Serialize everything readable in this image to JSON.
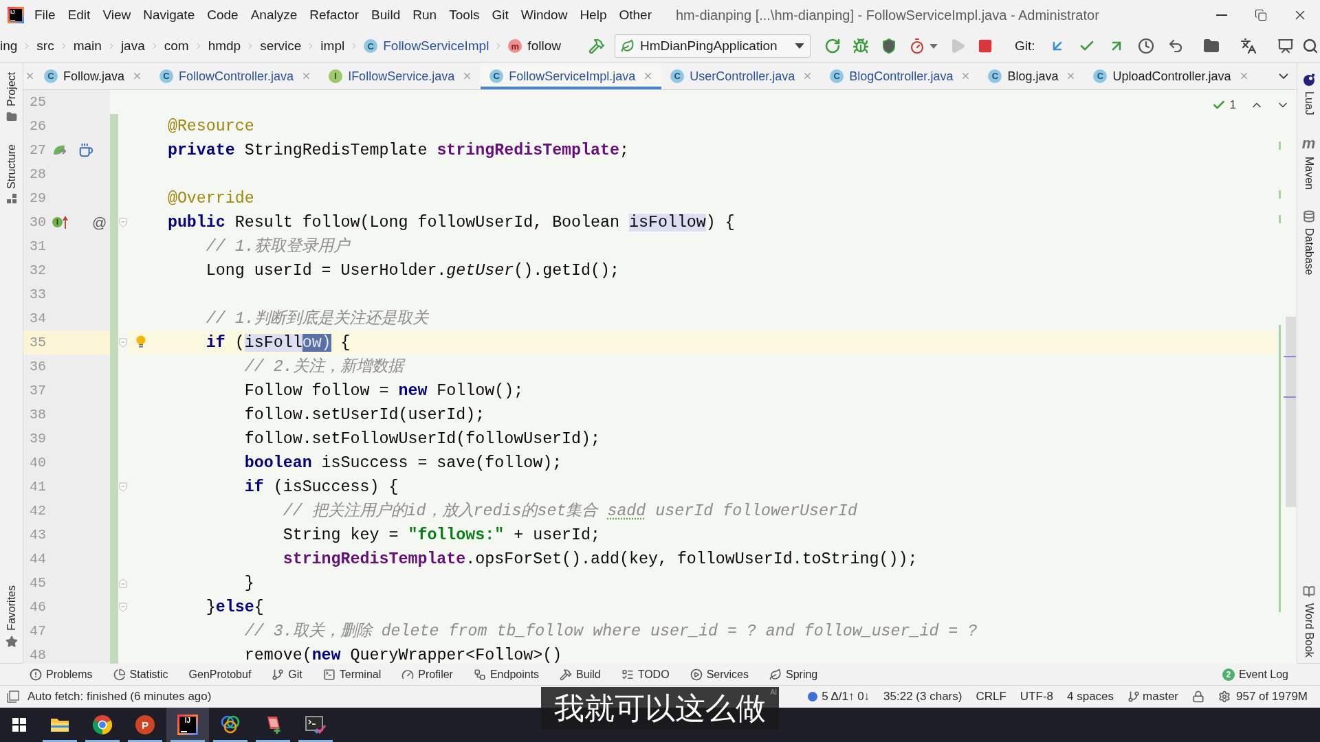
{
  "window": {
    "logo": "IJ",
    "menu": [
      {
        "label": "File"
      },
      {
        "label": "Edit"
      },
      {
        "label": "View"
      },
      {
        "label": "Navigate"
      },
      {
        "label": "Code"
      },
      {
        "label": "Analyze"
      },
      {
        "label": "Refactor"
      },
      {
        "label": "Build"
      },
      {
        "label": "Run"
      },
      {
        "label": "Tools"
      },
      {
        "label": "Git"
      },
      {
        "label": "Window"
      },
      {
        "label": "Help"
      },
      {
        "label": "Other"
      }
    ],
    "title": "hm-dianping [...\\hm-dianping] - FollowServiceImpl.java - Administrator"
  },
  "navigation_bar": {
    "breadcrumbs": [
      {
        "label": "ing",
        "kind": "module"
      },
      {
        "label": "src",
        "kind": "folder"
      },
      {
        "label": "main",
        "kind": "folder"
      },
      {
        "label": "java",
        "kind": "folder"
      },
      {
        "label": "com",
        "kind": "package"
      },
      {
        "label": "hmdp",
        "kind": "package"
      },
      {
        "label": "service",
        "kind": "package"
      },
      {
        "label": "impl",
        "kind": "package"
      },
      {
        "label": "FollowServiceImpl",
        "kind": "class",
        "glyph": "C"
      },
      {
        "label": "follow",
        "kind": "method",
        "glyph": "m"
      }
    ],
    "run_configuration": "HmDianPingApplication",
    "toolbar": [
      {
        "kind": "rerun",
        "disabled": false
      },
      {
        "kind": "debug",
        "disabled": false
      },
      {
        "kind": "coverage",
        "disabled": false
      },
      {
        "kind": "profiler",
        "disabled": false
      },
      {
        "kind": "run",
        "disabled": true
      },
      {
        "kind": "stop",
        "disabled": false
      }
    ],
    "git_label": "Git:"
  },
  "editor_tabs": [
    {
      "glyph": "C",
      "kind": "class",
      "label": "Follow.java",
      "modified": false,
      "selected": false
    },
    {
      "glyph": "C",
      "kind": "class",
      "label": "FollowController.java",
      "modified": true,
      "selected": false
    },
    {
      "glyph": "I",
      "kind": "interface",
      "label": "IFollowService.java",
      "modified": true,
      "selected": false
    },
    {
      "glyph": "C",
      "kind": "class",
      "label": "FollowServiceImpl.java",
      "modified": true,
      "selected": true
    },
    {
      "glyph": "C",
      "kind": "class",
      "label": "UserController.java",
      "modified": true,
      "selected": false
    },
    {
      "glyph": "C",
      "kind": "class",
      "label": "BlogController.java",
      "modified": true,
      "selected": false
    },
    {
      "glyph": "C",
      "kind": "class",
      "label": "Blog.java",
      "modified": false,
      "selected": false
    },
    {
      "glyph": "C",
      "kind": "class",
      "label": "UploadController.java",
      "modified": false,
      "selected": false
    }
  ],
  "left_stripe": [
    {
      "label": "Project",
      "kind": "project"
    },
    {
      "label": "Structure",
      "kind": "structure"
    },
    {
      "label": "Favorites",
      "kind": "favorites"
    }
  ],
  "right_stripe": [
    {
      "label": "LuaJ",
      "kind": "luaj"
    },
    {
      "label": "Maven",
      "kind": "maven",
      "glyph": "m"
    },
    {
      "label": "Database",
      "kind": "database"
    },
    {
      "label": "Word Book",
      "kind": "wordbook"
    }
  ],
  "editor": {
    "inspections": "1",
    "lines": [
      {
        "number": "25",
        "changed": false,
        "current": false
      },
      {
        "number": "26",
        "changed": true,
        "current": false,
        "segments": [
          {
            "text": "    @Resource",
            "kind": "annotation"
          }
        ]
      },
      {
        "number": "27",
        "changed": true,
        "current": false,
        "markers": [
          {
            "kind": "bean"
          },
          {
            "kind": "java"
          }
        ],
        "segments": [
          {
            "text": "    private",
            "kind": "keyword"
          },
          {
            "text": " StringRedisTemplate ",
            "kind": "plain"
          },
          {
            "text": "stringRedisTemplate",
            "kind": "field"
          },
          {
            "text": ";",
            "kind": "plain"
          }
        ]
      },
      {
        "number": "28",
        "changed": true,
        "current": false
      },
      {
        "number": "29",
        "changed": true,
        "current": false,
        "segments": [
          {
            "text": "    @Override",
            "kind": "annotation"
          }
        ]
      },
      {
        "number": "30",
        "changed": true,
        "current": false,
        "fold_start": true,
        "markers": [
          {
            "kind": "implements",
            "glyph": "I"
          },
          {
            "kind": "annotation",
            "glyph": "@"
          }
        ],
        "segments": [
          {
            "text": "    public",
            "kind": "keyword"
          },
          {
            "text": " Result follow(Long followUserId, Boolean ",
            "kind": "plain"
          },
          {
            "text": "isFollow",
            "kind": "usage"
          },
          {
            "text": ") {",
            "kind": "plain"
          }
        ]
      },
      {
        "number": "31",
        "changed": true,
        "current": false,
        "segments": [
          {
            "text": "        // 1.获取登录用户",
            "kind": "comment"
          }
        ]
      },
      {
        "number": "32",
        "changed": true,
        "current": false,
        "segments": [
          {
            "text": "        Long userId = UserHolder.",
            "kind": "plain"
          },
          {
            "text": "getUser",
            "kind": "static"
          },
          {
            "text": "().getId();",
            "kind": "plain"
          }
        ]
      },
      {
        "number": "33",
        "changed": true,
        "current": false
      },
      {
        "number": "34",
        "changed": true,
        "current": false,
        "segments": [
          {
            "text": "        // 1.判断到底是关注还是取关",
            "kind": "comment"
          }
        ]
      },
      {
        "number": "35",
        "changed": true,
        "current": true,
        "fold_start": true,
        "bulb": true,
        "segments": [
          {
            "text": "        if",
            "kind": "keyword"
          },
          {
            "text": " (",
            "kind": "plain"
          },
          {
            "text": "isFoll",
            "kind": "usage"
          },
          {
            "text": "ow)",
            "kind": "selection"
          },
          {
            "text": " {",
            "kind": "plain"
          }
        ]
      },
      {
        "number": "36",
        "changed": true,
        "current": false,
        "segments": [
          {
            "text": "            // 2.关注，新增数据",
            "kind": "comment"
          }
        ]
      },
      {
        "number": "37",
        "changed": true,
        "current": false,
        "segments": [
          {
            "text": "            Follow follow = ",
            "kind": "plain"
          },
          {
            "text": "new",
            "kind": "keyword"
          },
          {
            "text": " Follow();",
            "kind": "plain"
          }
        ]
      },
      {
        "number": "38",
        "changed": true,
        "current": false,
        "segments": [
          {
            "text": "            follow.setUserId(userId);",
            "kind": "plain"
          }
        ]
      },
      {
        "number": "39",
        "changed": true,
        "current": false,
        "segments": [
          {
            "text": "            follow.setFollowUserId(followUserId);",
            "kind": "plain"
          }
        ]
      },
      {
        "number": "40",
        "changed": true,
        "current": false,
        "segments": [
          {
            "text": "            boolean",
            "kind": "keyword"
          },
          {
            "text": " isSuccess = save(follow);",
            "kind": "plain"
          }
        ]
      },
      {
        "number": "41",
        "changed": true,
        "current": false,
        "fold_start": true,
        "segments": [
          {
            "text": "            if",
            "kind": "keyword"
          },
          {
            "text": " (isSuccess) {",
            "kind": "plain"
          }
        ]
      },
      {
        "number": "42",
        "changed": true,
        "current": false,
        "segments": [
          {
            "text": "                // 把关注用户的id，放入redis的set集合 ",
            "kind": "comment"
          },
          {
            "text": "sadd",
            "kind": "typo"
          },
          {
            "text": " userId followerUserId",
            "kind": "comment"
          }
        ]
      },
      {
        "number": "43",
        "changed": true,
        "current": false,
        "segments": [
          {
            "text": "                String key = ",
            "kind": "plain"
          },
          {
            "text": "\"follows:\"",
            "kind": "string"
          },
          {
            "text": " + userId;",
            "kind": "plain"
          }
        ]
      },
      {
        "number": "44",
        "changed": true,
        "current": false,
        "segments": [
          {
            "text": "                stringRedisTemplate",
            "kind": "field"
          },
          {
            "text": ".opsForSet().add(key, followUserId.toString());",
            "kind": "plain"
          }
        ]
      },
      {
        "number": "45",
        "changed": true,
        "current": false,
        "fold_end": true,
        "segments": [
          {
            "text": "            }",
            "kind": "plain"
          }
        ]
      },
      {
        "number": "46",
        "changed": true,
        "current": false,
        "fold_start": true,
        "segments": [
          {
            "text": "        }",
            "kind": "plain"
          },
          {
            "text": "else",
            "kind": "keyword"
          },
          {
            "text": "{",
            "kind": "plain"
          }
        ]
      },
      {
        "number": "47",
        "changed": true,
        "current": false,
        "segments": [
          {
            "text": "            // 3.取关，删除 delete from tb_follow where user_id = ? and follow_user_id = ?",
            "kind": "comment"
          }
        ]
      },
      {
        "number": "48",
        "changed": true,
        "current": false,
        "segments": [
          {
            "text": "            remove(",
            "kind": "plain"
          },
          {
            "text": "new",
            "kind": "keyword"
          },
          {
            "text": " QueryWrapper<Follow>()",
            "kind": "plain"
          }
        ]
      }
    ]
  },
  "tool_windows": [
    {
      "label": "Problems",
      "kind": "problems"
    },
    {
      "label": "Statistic",
      "kind": "statistic"
    },
    {
      "label": "GenProtobuf",
      "kind": "plain"
    },
    {
      "label": "Git",
      "kind": "git"
    },
    {
      "label": "Terminal",
      "kind": "terminal"
    },
    {
      "label": "Profiler",
      "kind": "profiler"
    },
    {
      "label": "Endpoints",
      "kind": "endpoints"
    },
    {
      "label": "Build",
      "kind": "build"
    },
    {
      "label": "TODO",
      "kind": "todo"
    },
    {
      "label": "Services",
      "kind": "services"
    },
    {
      "label": "Spring",
      "kind": "spring"
    }
  ],
  "event_log": {
    "label": "Event Log",
    "count": "2"
  },
  "status_bar": {
    "message": "Auto fetch: finished (6 minutes ago)",
    "widgets": [
      {
        "kind": "vcs",
        "text": "5 Δ/1↑ 0↓"
      },
      {
        "kind": "text",
        "text": "35:22 (3 chars)"
      },
      {
        "kind": "text",
        "text": "CRLF"
      },
      {
        "kind": "text",
        "text": "UTF-8"
      },
      {
        "kind": "text",
        "text": "4 spaces"
      },
      {
        "kind": "branch",
        "text": "master"
      },
      {
        "kind": "lock"
      },
      {
        "kind": "memory",
        "text": "957 of 1979M"
      }
    ]
  },
  "taskbar": {
    "apps": [
      {
        "kind": "explorer",
        "running": true,
        "selected": false
      },
      {
        "kind": "chrome",
        "running": true,
        "selected": false
      },
      {
        "kind": "powerpoint",
        "glyph": "P",
        "running": true,
        "selected": false
      },
      {
        "kind": "intellij",
        "glyph": "IJ",
        "running": true,
        "selected": true
      },
      {
        "kind": "rings",
        "running": true,
        "selected": false
      },
      {
        "kind": "notes",
        "running": true,
        "selected": false
      },
      {
        "kind": "terminal",
        "running": true,
        "selected": false
      }
    ]
  },
  "subtitle": {
    "text": "我就可以这么做",
    "tag": "AI"
  }
}
